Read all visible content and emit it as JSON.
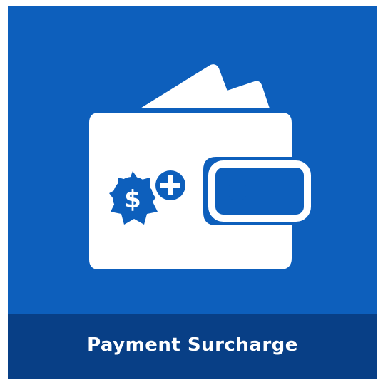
{
  "product": {
    "title": "Payment Surcharge",
    "icon": "wallet-with-dollar-plus-badge-icon"
  },
  "colors": {
    "tile_background": "#0d5fbc",
    "label_background": "#083f86",
    "icon_fill": "#ffffff",
    "text": "#ffffff"
  }
}
